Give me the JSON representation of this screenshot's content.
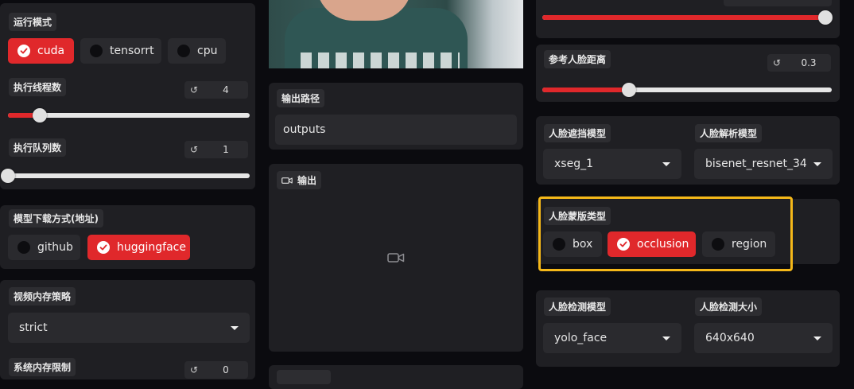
{
  "left": {
    "run_mode": {
      "label": "运行模式",
      "options": [
        {
          "label": "cuda",
          "selected": true
        },
        {
          "label": "tensorrt",
          "selected": false
        },
        {
          "label": "cpu",
          "selected": false
        }
      ]
    },
    "threads": {
      "label": "执行线程数",
      "value": "4",
      "level": 0.13
    },
    "queue": {
      "label": "执行队列数",
      "value": "1",
      "level": 0.0
    },
    "download": {
      "label": "模型下载方式(地址)",
      "options": [
        {
          "label": "github",
          "selected": false
        },
        {
          "label": "huggingface",
          "selected": true
        }
      ]
    },
    "video_memory": {
      "label": "视频内存策略",
      "value": "strict"
    },
    "system_memory": {
      "label": "系统内存限制",
      "value": "0"
    }
  },
  "middle": {
    "output_path": {
      "label": "输出路径",
      "value": "outputs"
    },
    "output": {
      "label": "输出"
    }
  },
  "right": {
    "top_slider": {
      "level": 1.0
    },
    "ref_distance": {
      "label": "参考人脸距离",
      "value": "0.3",
      "level": 0.3
    },
    "occluder_model": {
      "label": "人脸遮挡模型",
      "value": "xseg_1"
    },
    "parser_model": {
      "label": "人脸解析模型",
      "value": "bisenet_resnet_34"
    },
    "mask_types": {
      "label": "人脸蒙版类型",
      "options": [
        {
          "label": "box",
          "selected": false
        },
        {
          "label": "occlusion",
          "selected": true
        },
        {
          "label": "region",
          "selected": false
        }
      ]
    },
    "detector_model": {
      "label": "人脸检测模型",
      "value": "yolo_face"
    },
    "detector_size": {
      "label": "人脸检测大小",
      "value": "640x640"
    }
  },
  "icons": {
    "reset": "reset-icon",
    "video": "video-camera-icon",
    "check": "check-icon",
    "caret": "chevron-down-icon"
  },
  "colors": {
    "accent": "#e0282b",
    "highlight": "#f5b819",
    "panel": "#1f1f23",
    "background": "#0b0b0f"
  }
}
